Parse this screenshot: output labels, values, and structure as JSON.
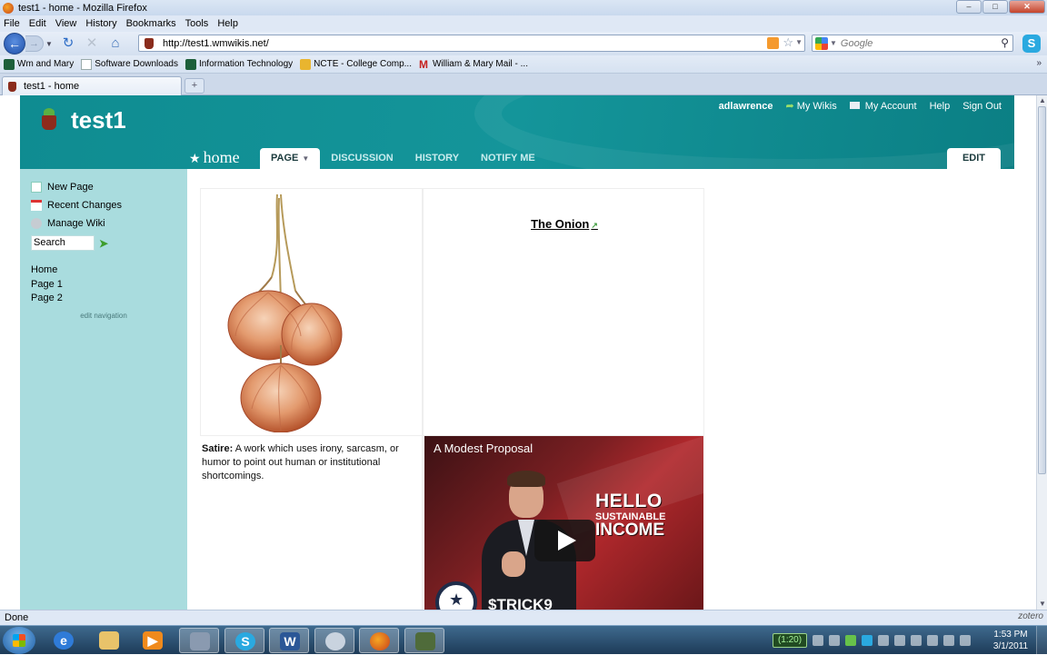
{
  "window": {
    "title": "test1 - home - Mozilla Firefox",
    "controls": {
      "minimize": "‒",
      "maximize": "□",
      "close": "✕"
    }
  },
  "menu": [
    "File",
    "Edit",
    "View",
    "History",
    "Bookmarks",
    "Tools",
    "Help"
  ],
  "address": {
    "url": "http://test1.wmwikis.net/"
  },
  "search": {
    "placeholder": "Google"
  },
  "bookmarks": [
    {
      "label": "Wm and Mary",
      "icon": "wm-favicon"
    },
    {
      "label": "Software Downloads",
      "icon": "page-icon"
    },
    {
      "label": "Information Technology",
      "icon": "wm-favicon"
    },
    {
      "label": "NCTE - College Comp...",
      "icon": "ncte-favicon"
    },
    {
      "label": "William & Mary Mail - ...",
      "icon": "gmail-icon"
    }
  ],
  "tab": {
    "label": "test1 - home"
  },
  "wiki": {
    "name": "test1",
    "user": "adlawrence",
    "user_links": [
      "My Wikis",
      "My Account",
      "Help",
      "Sign Out"
    ],
    "page_name": "home",
    "tabs": [
      "PAGE",
      "DISCUSSION",
      "HISTORY",
      "NOTIFY ME"
    ],
    "edit_label": "EDIT",
    "sidebar": {
      "actions": [
        "New Page",
        "Recent Changes",
        "Manage Wiki"
      ],
      "search_value": "Search",
      "nav": [
        "Home",
        "Page 1",
        "Page 2"
      ],
      "edit_nav": "edit navigation"
    },
    "content": {
      "link_title": "The Onion",
      "satire_term": "Satire:",
      "satire_text": " A work which uses irony, sarcasm, or humor to point out human or institutional shortcomings.",
      "video_title": "A Modest Proposal",
      "video_hello": "HELLO",
      "video_sustainable": "SUSTAINABLE",
      "video_income": "INCOME",
      "video_ticker": "$TRICK9"
    }
  },
  "status": {
    "text": "Done",
    "zotero": "zotero"
  },
  "taskbar": {
    "battery": "(1:20)",
    "time": "1:53 PM",
    "date": "3/1/2011"
  },
  "colors": {
    "wiki_teal": "#0f8c91",
    "sidebar": "#a9dcde"
  }
}
